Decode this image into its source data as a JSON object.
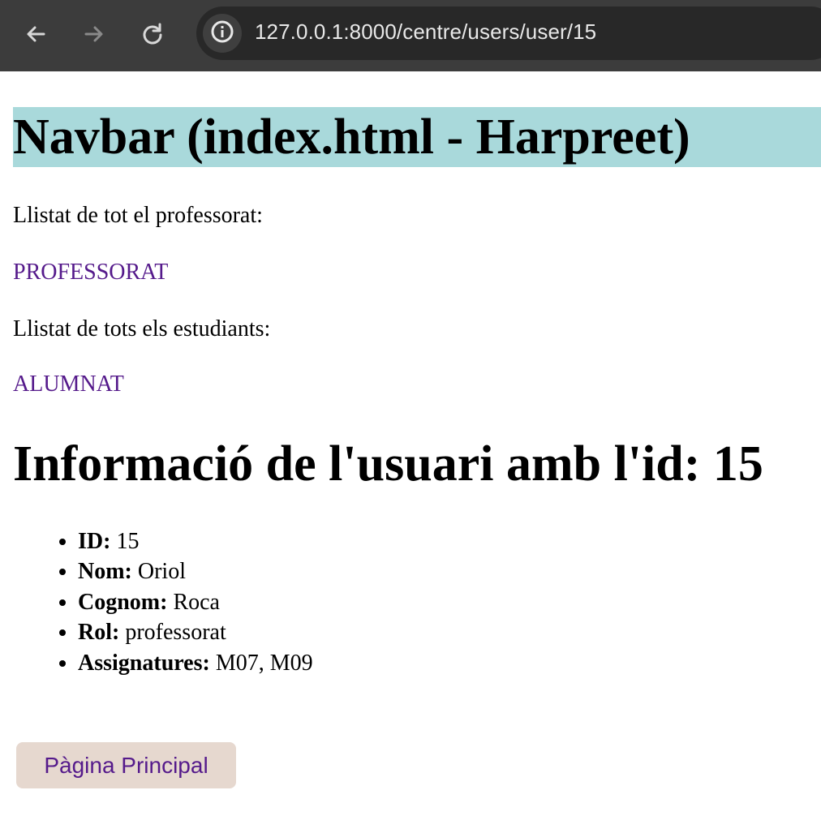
{
  "browser": {
    "url": "127.0.0.1:8000/centre/users/user/15",
    "back_icon": "arrow-left-icon",
    "forward_icon": "arrow-right-icon",
    "reload_icon": "reload-icon",
    "site_info_icon": "info-icon"
  },
  "page": {
    "navbar_title": "Navbar (index.html - Harpreet)",
    "teachers_text": "Llistat de tot el professorat:",
    "teachers_link": "PROFESSORAT",
    "students_text": "Llistat de tots els estudiants:",
    "students_link": "ALUMNAT",
    "user_heading": "Informació de l'usuari amb l'id: 15",
    "user_fields": [
      {
        "label": "ID:",
        "value": "15"
      },
      {
        "label": "Nom:",
        "value": "Oriol"
      },
      {
        "label": "Cognom:",
        "value": "Roca"
      },
      {
        "label": "Rol:",
        "value": "professorat"
      },
      {
        "label": "Assignatures:",
        "value": "M07, M09"
      }
    ],
    "home_button": "Pàgina Principal"
  },
  "colors": {
    "browser_chrome": "#3c3c3c",
    "omnibox": "#282828",
    "navbar_background": "#a9d9db",
    "link": "#551a8b",
    "home_button_background": "#e6d8cf"
  }
}
